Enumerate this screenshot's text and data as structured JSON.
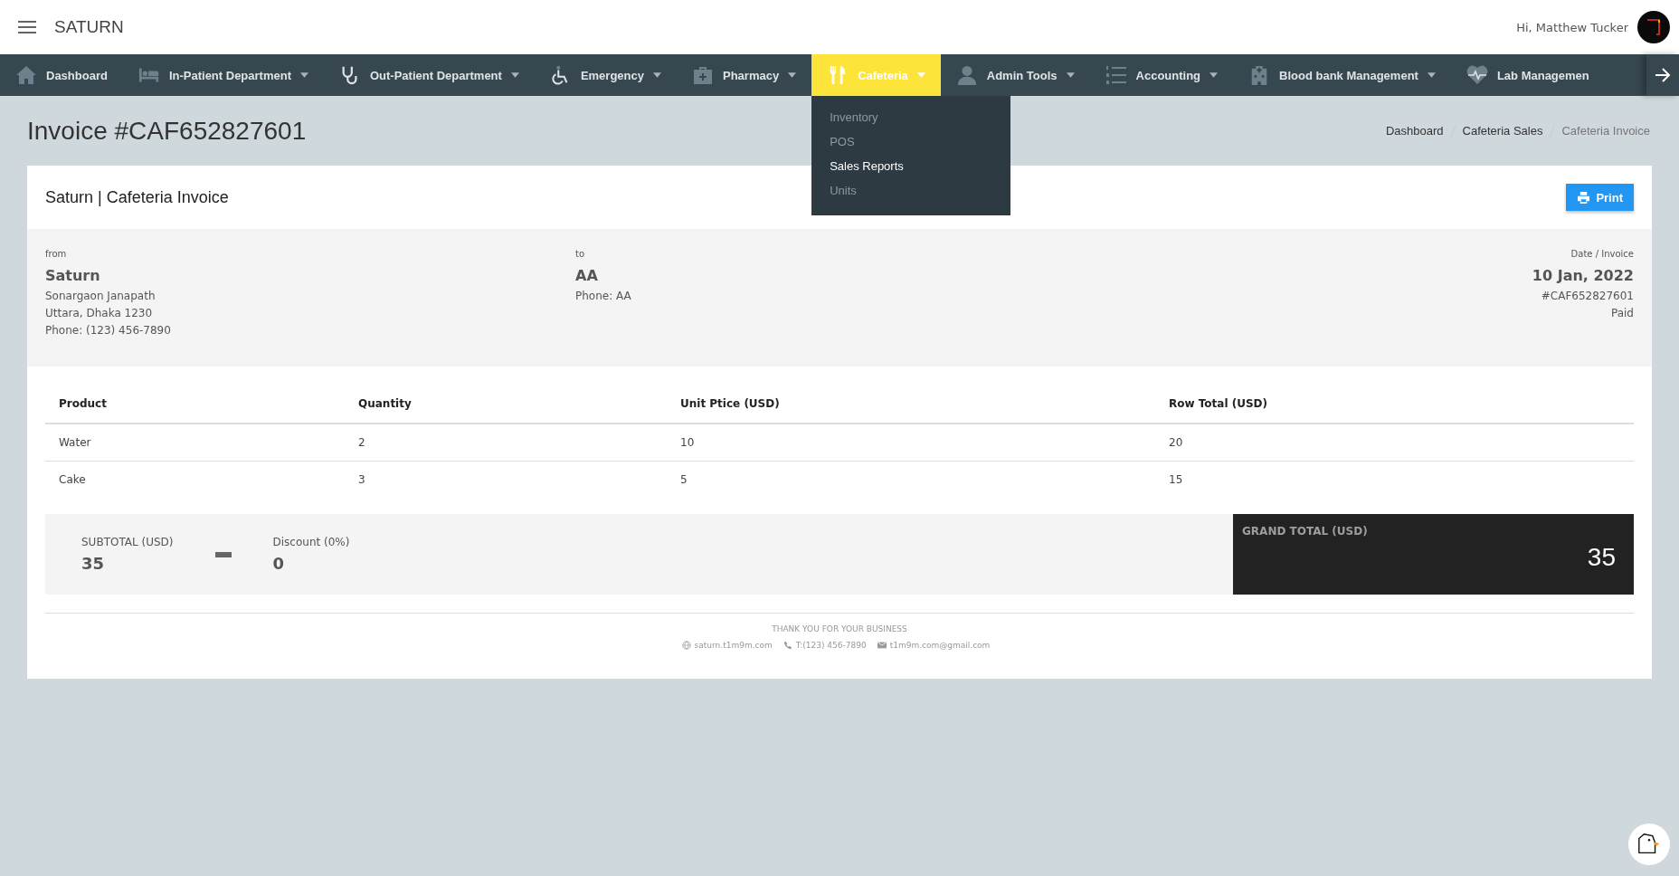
{
  "header": {
    "brand": "SATURN",
    "greeting": "Hi, Matthew Tucker"
  },
  "nav": [
    {
      "label": "Dashboard",
      "caret": false,
      "selected": false
    },
    {
      "label": "In-Patient Department",
      "caret": true,
      "selected": false
    },
    {
      "label": "Out-Patient Department",
      "caret": true,
      "selected": false
    },
    {
      "label": "Emergency",
      "caret": true,
      "selected": false
    },
    {
      "label": "Pharmacy",
      "caret": true,
      "selected": false
    },
    {
      "label": "Cafeteria",
      "caret": true,
      "selected": true
    },
    {
      "label": "Admin Tools",
      "caret": true,
      "selected": false
    },
    {
      "label": "Accounting",
      "caret": true,
      "selected": false
    },
    {
      "label": "Blood bank Management",
      "caret": true,
      "selected": false
    },
    {
      "label": "Lab Managemen",
      "caret": false,
      "selected": false
    }
  ],
  "dropdown": [
    {
      "label": "Inventory",
      "selected": false
    },
    {
      "label": "POS",
      "selected": false
    },
    {
      "label": "Sales Reports",
      "selected": true
    },
    {
      "label": "Units",
      "selected": false
    }
  ],
  "page_title": "Invoice #CAF652827601",
  "breadcrumb": [
    {
      "label": "Dashboard",
      "current": false
    },
    {
      "label": "Cafeteria Sales",
      "current": false
    },
    {
      "label": "Cafeteria Invoice",
      "current": true
    }
  ],
  "card": {
    "title": "Saturn | Cafeteria Invoice",
    "print_button": "Print"
  },
  "from": {
    "label": "from",
    "name": "Saturn",
    "lines": [
      "Sonargaon Janapath",
      "Uttara, Dhaka 1230",
      "Phone: (123) 456-7890"
    ]
  },
  "to": {
    "label": "to",
    "name": "AA",
    "lines": [
      "Phone: AA"
    ]
  },
  "meta": {
    "label": "Date / Invoice",
    "date": "10 Jan, 2022",
    "lines": [
      "#CAF652827601",
      "Paid"
    ]
  },
  "table": {
    "columns": [
      "Product",
      "Quantity",
      "Unit Ptice (USD)",
      "Row Total (USD)"
    ],
    "rows": [
      [
        "Water",
        "2",
        "10",
        "20"
      ],
      [
        "Cake",
        "3",
        "5",
        "15"
      ]
    ]
  },
  "summary": {
    "subtotal_label": "SUBTOTAL (USD)",
    "subtotal": "35",
    "discount_label": "Discount (0%)",
    "discount": "0",
    "grand_total_label": "GRAND TOTAL (USD)",
    "grand_total": "35"
  },
  "footer": {
    "thanks": "THANK YOU FOR YOUR BUSINESS",
    "website": "saturn.t1m9m.com",
    "phone": "T:(123) 456-7890",
    "email": "t1m9m.com@gmail.com"
  }
}
